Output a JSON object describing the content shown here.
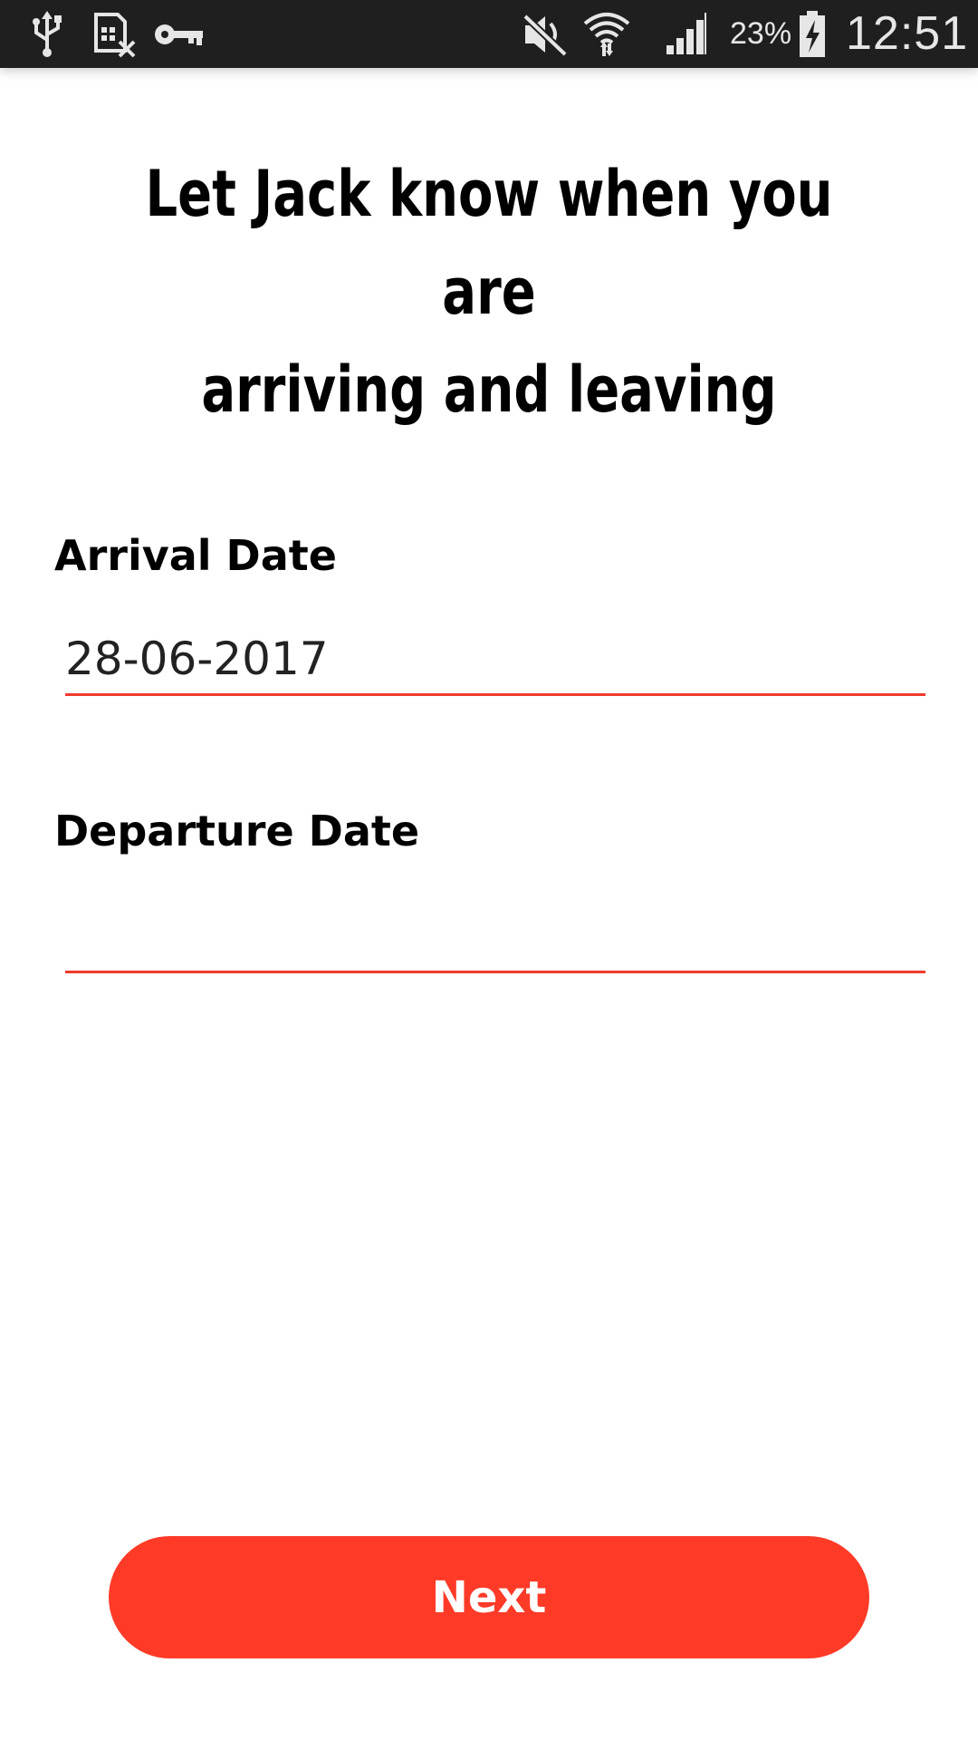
{
  "status_bar": {
    "battery_percent": "23%",
    "time": "12:51",
    "icons": [
      "usb-icon",
      "sim-card-off-icon",
      "vpn-key-icon",
      "mute-icon",
      "wifi-icon",
      "signal-icon",
      "battery-charging-icon"
    ]
  },
  "headline": {
    "line1": "Let Jack know when you are",
    "line2": "arriving and leaving"
  },
  "form": {
    "arrival_label": "Arrival Date",
    "arrival_value": "28-06-2017",
    "departure_label": "Departure Date",
    "departure_value": ""
  },
  "next_button": {
    "label": "Next"
  },
  "colors": {
    "accent": "#ff3b28",
    "underline": "#ef3b2c",
    "status_bar_bg": "#1f1f1f"
  }
}
